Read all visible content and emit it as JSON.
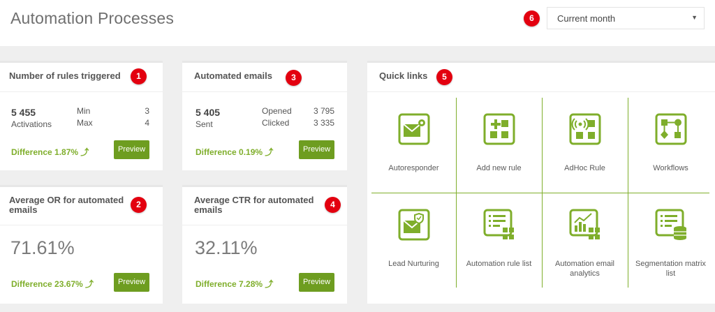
{
  "header": {
    "title": "Automation Processes",
    "period_select": {
      "value": "Current month"
    }
  },
  "badges": [
    "1",
    "2",
    "3",
    "4",
    "5",
    "6"
  ],
  "rules_card": {
    "title": "Number of rules triggered",
    "main_value": "5 455",
    "main_label": "Activations",
    "stats": [
      {
        "label": "Min",
        "value": "3"
      },
      {
        "label": "Max",
        "value": "4"
      }
    ],
    "difference": "Difference 1.87% ⤴",
    "preview": "Preview"
  },
  "emails_card": {
    "title": "Automated emails",
    "main_value": "5 405",
    "main_label": "Sent",
    "stats": [
      {
        "label": "Opened",
        "value": "3 795"
      },
      {
        "label": "Clicked",
        "value": "3 335"
      }
    ],
    "difference": "Difference 0.19% ⤴",
    "preview": "Preview"
  },
  "or_card": {
    "title_line1": "Average OR for automated",
    "title_line2": "emails",
    "value": "71.61%",
    "difference": "Difference 23.67% ⤴",
    "preview": "Preview"
  },
  "ctr_card": {
    "title_line1": "Average CTR for automated",
    "title_line2": "emails",
    "value": "32.11%",
    "difference": "Difference 7.28% ⤴",
    "preview": "Preview"
  },
  "quick_links": {
    "title": "Quick links",
    "items": [
      {
        "label": "Autoresponder",
        "icon": "envelope-gear-icon"
      },
      {
        "label": "Add new rule",
        "icon": "add-rule-grid-icon"
      },
      {
        "label": "AdHoc Rule",
        "icon": "signal-grid-icon"
      },
      {
        "label": "Workflows",
        "icon": "workflow-icon"
      },
      {
        "label": "Lead Nurturing",
        "icon": "envelope-shield-icon"
      },
      {
        "label": "Automation rule list",
        "icon": "rule-list-icon"
      },
      {
        "label": "Automation email analytics",
        "icon": "analytics-chart-icon"
      },
      {
        "label": "Segmentation matrix list",
        "icon": "matrix-database-icon"
      }
    ]
  },
  "colors": {
    "accent_green": "#7fae2b",
    "button_green": "#6e9d20",
    "badge_red": "#e3000f"
  }
}
